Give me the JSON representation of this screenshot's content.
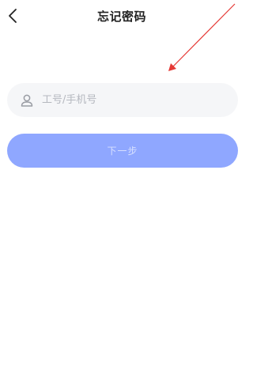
{
  "header": {
    "title": "忘记密码",
    "back_icon": "chevron-left-icon"
  },
  "form": {
    "account_placeholder": "工号/手机号",
    "account_value": "",
    "user_icon": "user-icon"
  },
  "actions": {
    "next_label": "下一步"
  },
  "colors": {
    "primary_disabled": "#8fa7ff",
    "input_bg": "#f5f6f8",
    "annotation": "#e53935"
  }
}
